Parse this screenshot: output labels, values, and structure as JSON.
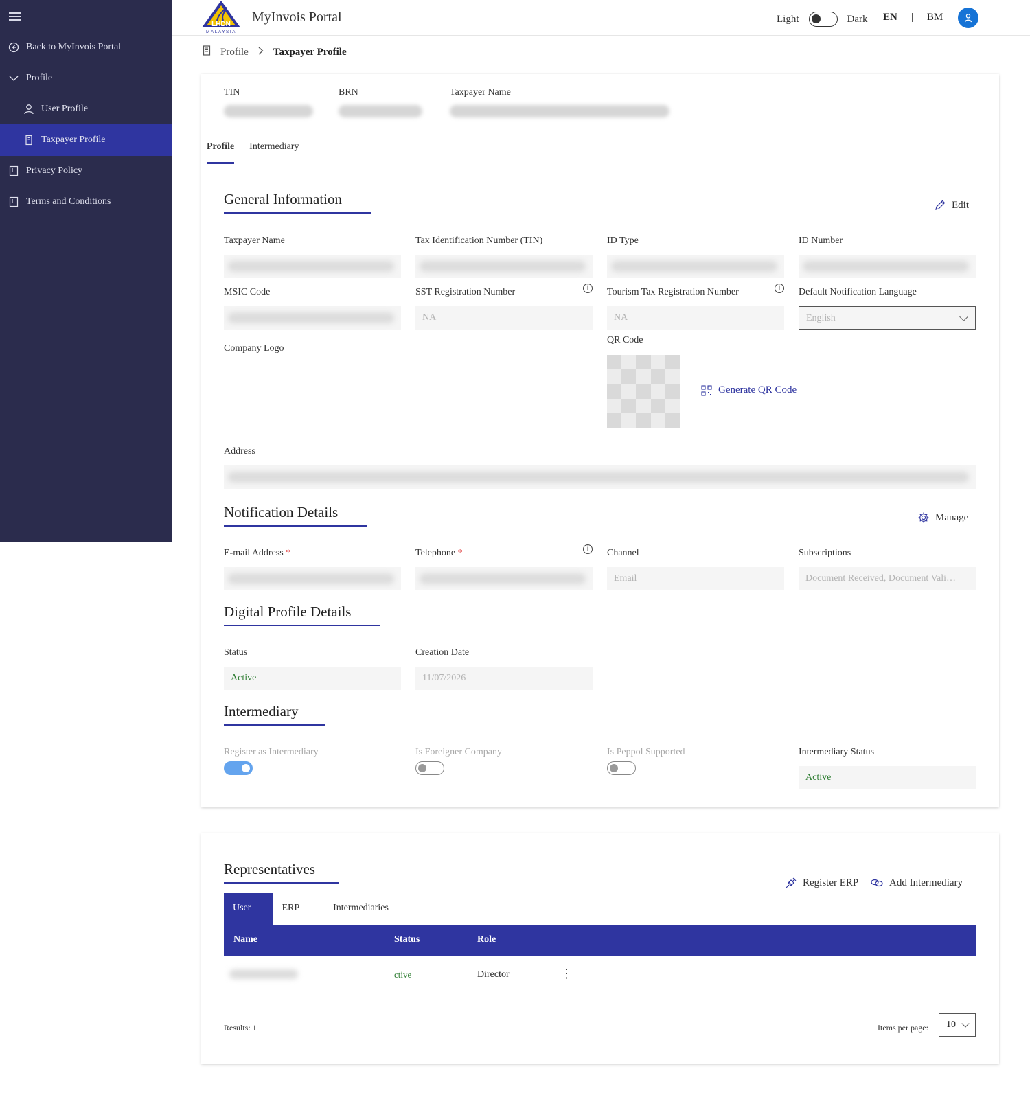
{
  "app": {
    "title": "MyInvois Portal",
    "logo_text": "LHDN",
    "logo_sub": "MALAYSIA"
  },
  "theme": {
    "light_label": "Light",
    "dark_label": "Dark"
  },
  "lang": {
    "en": "EN",
    "separator": "|",
    "bm": "BM"
  },
  "sidebar": {
    "items": [
      {
        "label": "Back to MyInvois Portal",
        "icon": "back-circle-icon"
      },
      {
        "label": "Profile",
        "icon": "chevron-down-icon"
      },
      {
        "label": "User Profile",
        "icon": "user-icon"
      },
      {
        "label": "Taxpayer Profile",
        "icon": "building-icon"
      },
      {
        "label": "Privacy Policy",
        "icon": "document-icon"
      },
      {
        "label": "Terms and Conditions",
        "icon": "document-icon"
      }
    ]
  },
  "breadcrumb": {
    "parent": "Profile",
    "current": "Taxpayer Profile"
  },
  "header": {
    "tin_label": "TIN",
    "brn_label": "BRN",
    "name_label": "Taxpayer Name"
  },
  "tabs": [
    {
      "label": "Profile"
    },
    {
      "label": "Intermediary"
    }
  ],
  "general": {
    "title": "General Information",
    "edit_label": "Edit",
    "taxpayer_name": "Taxpayer Name",
    "tin": "Tax Identification Number (TIN)",
    "id_type": "ID Type",
    "id_number": "ID Number",
    "msic": "MSIC Code",
    "sst_label": "SST Registration Number",
    "sst_value": "NA",
    "tourism_label": "Tourism Tax Registration Number",
    "tourism_value": "NA",
    "notif_lang_label": "Default Notification Language",
    "notif_lang_value": "English",
    "company_logo": "Company Logo",
    "qr_label": "QR Code",
    "generate_qr": "Generate QR Code",
    "address": "Address",
    "info_glyph": "i"
  },
  "notification": {
    "title": "Notification Details",
    "manage_label": "Manage",
    "email_label": "E-mail Address",
    "telephone_label": "Telephone",
    "required_mark": "*",
    "channel_label": "Channel",
    "channel_value": "Email",
    "subscriptions_label": "Subscriptions",
    "subscriptions_value": "Document Received, Document Vali…"
  },
  "digital": {
    "title": "Digital Profile Details",
    "status_label": "Status",
    "status_value": "Active",
    "creation_label": "Creation Date",
    "creation_value": "11/07/2026"
  },
  "intermediary": {
    "title": "Intermediary",
    "register_label": "Register as Intermediary",
    "foreigner_label": "Is Foreigner Company",
    "peppol_label": "Is Peppol Supported",
    "status_label": "Intermediary Status",
    "status_value": "Active"
  },
  "representatives": {
    "title": "Representatives",
    "register_erp": "Register ERP",
    "add_intermediary": "Add Intermediary",
    "tabs": [
      {
        "label": "User"
      },
      {
        "label": "ERP"
      },
      {
        "label": "Intermediaries"
      }
    ],
    "columns": {
      "name": "Name",
      "status": "Status",
      "role": "Role"
    },
    "rows": [
      {
        "status": "ctive",
        "role": "Director",
        "menu": "⋮"
      }
    ],
    "results": "Results: 1",
    "items_per_page_label": "Items per page:",
    "items_per_page_value": "10"
  },
  "colors": {
    "sidebar": "#2b2c4d",
    "accent": "#2f35a0",
    "active_green": "#2e7d32",
    "avatar": "#1673d6"
  }
}
